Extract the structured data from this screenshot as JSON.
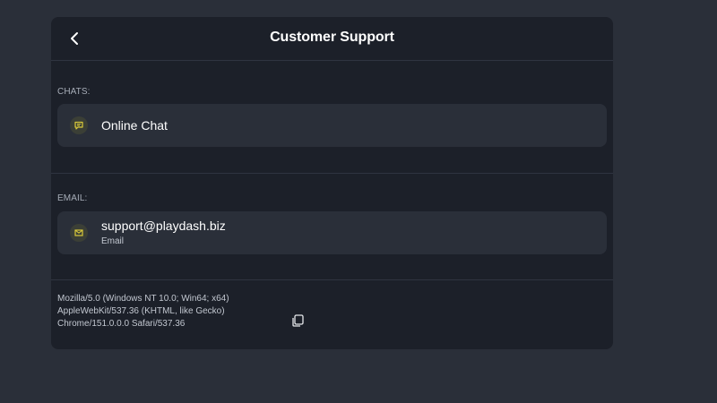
{
  "header": {
    "title": "Customer Support",
    "back_icon": "chevron-left-icon"
  },
  "sections": {
    "chats": {
      "label": "CHATS:",
      "item": {
        "title": "Online Chat",
        "icon": "chat-bubble-icon"
      }
    },
    "email": {
      "label": "EMAIL:",
      "item": {
        "title": "support@playdash.biz",
        "subtitle": "Email",
        "icon": "envelope-icon"
      }
    }
  },
  "footer": {
    "user_agent": "Mozilla/5.0 (Windows NT 10.0; Win64; x64) AppleWebKit/537.36 (KHTML, like Gecko) Chrome/151.0.0.0 Safari/537.36",
    "copy_icon": "copy-icon"
  },
  "colors": {
    "background": "#2a2f39",
    "panel": "#1c2029",
    "card": "#2a2f39",
    "accent": "#d9c93a"
  }
}
